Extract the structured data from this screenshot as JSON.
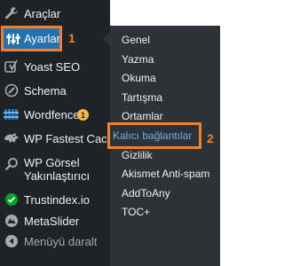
{
  "sidebar": {
    "items": [
      {
        "label": "Araçlar",
        "icon": "wrench-icon"
      },
      {
        "label": "Ayarlar",
        "icon": "settings-sliders-icon",
        "active": true
      },
      {
        "label": "Yoast SEO",
        "icon": "yoast-icon"
      },
      {
        "label": "Schema",
        "icon": "schema-icon"
      },
      {
        "label": "Wordfence",
        "icon": "wordfence-icon",
        "badge": "1"
      },
      {
        "label": "WP Fastest Cache",
        "icon": "cheetah-icon"
      },
      {
        "label": "WP Görsel",
        "label2": "Yakınlaştırıcı",
        "icon": "magnifier-icon"
      },
      {
        "label": "Trustindex.io",
        "icon": "check-shield-icon"
      },
      {
        "label": "MetaSlider",
        "icon": "metaslider-icon"
      },
      {
        "label": "Menüyü daralt",
        "icon": "collapse-arrow-icon"
      }
    ]
  },
  "submenu": {
    "items": [
      "Genel",
      "Yazma",
      "Okuma",
      "Tartışma",
      "Ortamlar",
      "Kalıcı bağlantılar",
      "Gizlilik",
      "Akismet Anti-spam",
      "AddToAny",
      "TOC+"
    ],
    "active_index": 5
  },
  "annotations": {
    "step1": "1",
    "step2": "2"
  },
  "colors": {
    "sidebar_bg": "#1d2327",
    "submenu_bg": "#2c3338",
    "active_bg": "#2271b1",
    "highlight": "#f0812b",
    "active_text": "#72aee6",
    "badge": "#f0b849"
  }
}
